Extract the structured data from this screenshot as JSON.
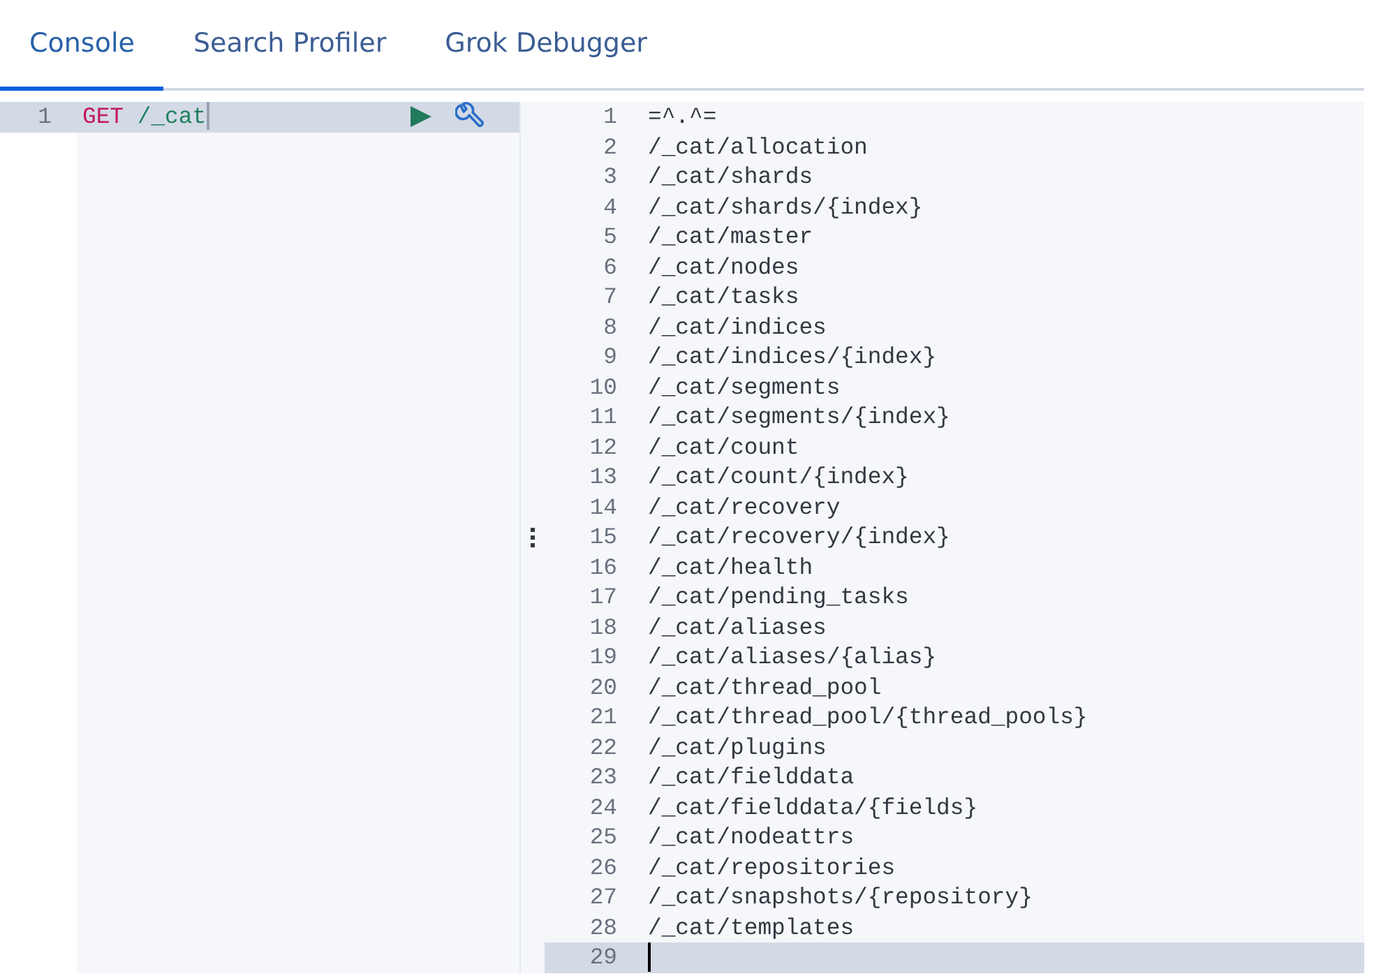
{
  "tabs": [
    {
      "label": "Console",
      "selected": true
    },
    {
      "label": "Search Profiler",
      "selected": false
    },
    {
      "label": "Grok Debugger",
      "selected": false
    }
  ],
  "request_editor": {
    "lines": [
      {
        "number": "1",
        "method": "GET",
        "path": "/_cat",
        "active": true
      }
    ]
  },
  "response_viewer": {
    "lines": [
      {
        "number": "1",
        "text": "=^.^=",
        "active": false
      },
      {
        "number": "2",
        "text": "/_cat/allocation",
        "active": false
      },
      {
        "number": "3",
        "text": "/_cat/shards",
        "active": false
      },
      {
        "number": "4",
        "text": "/_cat/shards/{index}",
        "active": false
      },
      {
        "number": "5",
        "text": "/_cat/master",
        "active": false
      },
      {
        "number": "6",
        "text": "/_cat/nodes",
        "active": false
      },
      {
        "number": "7",
        "text": "/_cat/tasks",
        "active": false
      },
      {
        "number": "8",
        "text": "/_cat/indices",
        "active": false
      },
      {
        "number": "9",
        "text": "/_cat/indices/{index}",
        "active": false
      },
      {
        "number": "10",
        "text": "/_cat/segments",
        "active": false
      },
      {
        "number": "11",
        "text": "/_cat/segments/{index}",
        "active": false
      },
      {
        "number": "12",
        "text": "/_cat/count",
        "active": false
      },
      {
        "number": "13",
        "text": "/_cat/count/{index}",
        "active": false
      },
      {
        "number": "14",
        "text": "/_cat/recovery",
        "active": false
      },
      {
        "number": "15",
        "text": "/_cat/recovery/{index}",
        "active": false
      },
      {
        "number": "16",
        "text": "/_cat/health",
        "active": false
      },
      {
        "number": "17",
        "text": "/_cat/pending_tasks",
        "active": false
      },
      {
        "number": "18",
        "text": "/_cat/aliases",
        "active": false
      },
      {
        "number": "19",
        "text": "/_cat/aliases/{alias}",
        "active": false
      },
      {
        "number": "20",
        "text": "/_cat/thread_pool",
        "active": false
      },
      {
        "number": "21",
        "text": "/_cat/thread_pool/{thread_pools}",
        "active": false
      },
      {
        "number": "22",
        "text": "/_cat/plugins",
        "active": false
      },
      {
        "number": "23",
        "text": "/_cat/fielddata",
        "active": false
      },
      {
        "number": "24",
        "text": "/_cat/fielddata/{fields}",
        "active": false
      },
      {
        "number": "25",
        "text": "/_cat/nodeattrs",
        "active": false
      },
      {
        "number": "26",
        "text": "/_cat/repositories",
        "active": false
      },
      {
        "number": "27",
        "text": "/_cat/snapshots/{repository}",
        "active": false
      },
      {
        "number": "28",
        "text": "/_cat/templates",
        "active": false
      },
      {
        "number": "29",
        "active": true
      }
    ]
  }
}
